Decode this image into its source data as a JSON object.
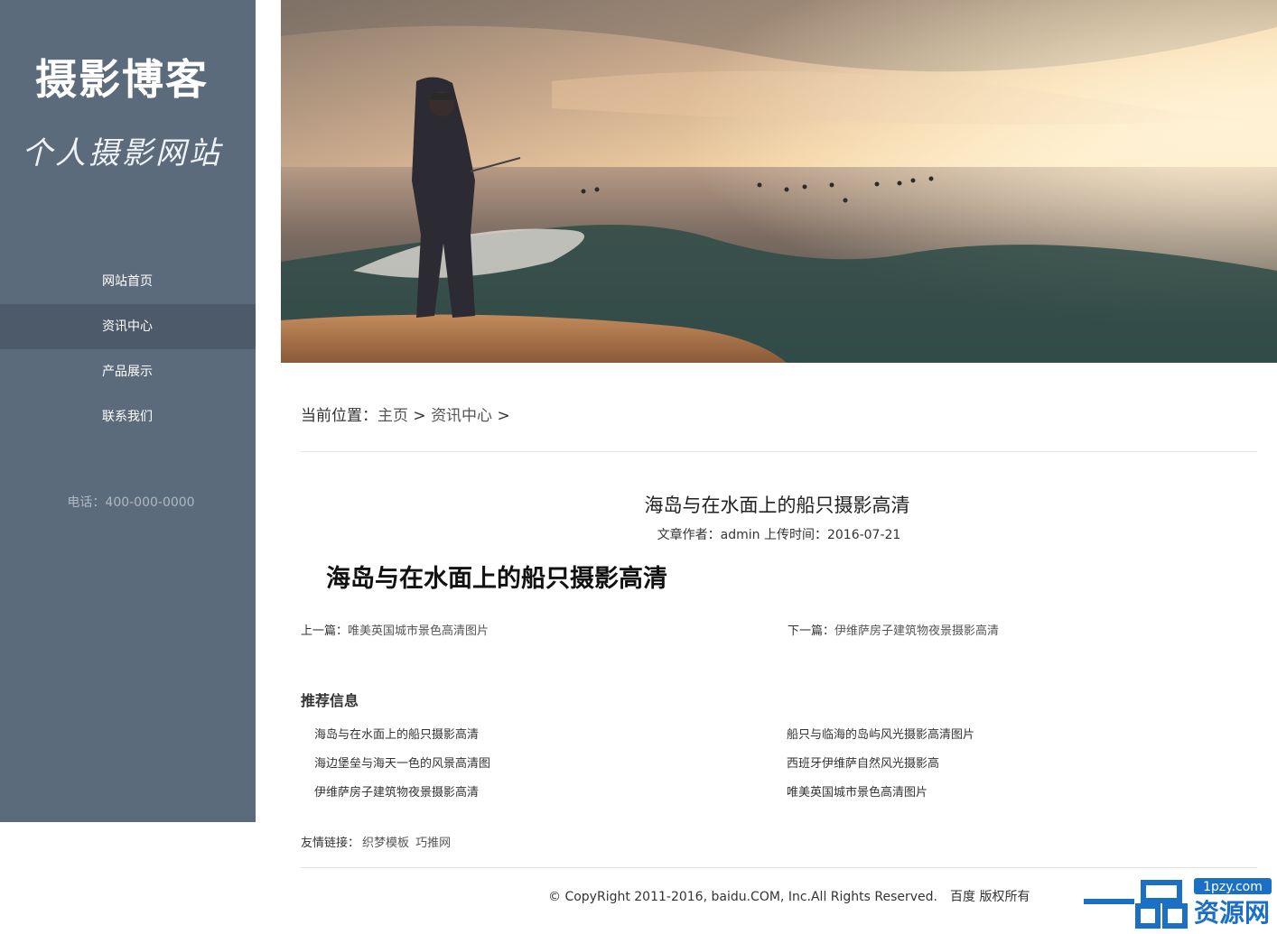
{
  "sidebar": {
    "title": "摄影博客",
    "subtitle": "个人摄影网站",
    "nav": [
      {
        "label": "网站首页",
        "active": false
      },
      {
        "label": "资讯中心",
        "active": true
      },
      {
        "label": "产品展示",
        "active": false
      },
      {
        "label": "联系我们",
        "active": false
      }
    ],
    "phone": "电话：400-000-0000"
  },
  "breadcrumb": {
    "prefix": "当前位置：",
    "home": "主页",
    "sep1": " > ",
    "section": "资讯中心",
    "sep2": " >"
  },
  "article": {
    "title": "海岛与在水面上的船只摄影高清",
    "meta": "文章作者：admin 上传时间：2016-07-21",
    "heading": "海岛与在水面上的船只摄影高清",
    "prev_label": "上一篇：",
    "prev_title": "唯美英国城市景色高清图片",
    "next_label": "下一篇：",
    "next_title": "伊维萨房子建筑物夜景摄影高清"
  },
  "recommend": {
    "title": "推荐信息",
    "left": [
      "海岛与在水面上的船只摄影高清",
      "海边堡垒与海天一色的风景高清图",
      "伊维萨房子建筑物夜景摄影高清"
    ],
    "right": [
      "船只与临海的岛屿风光摄影高清图片",
      "西班牙伊维萨自然风光摄影高",
      "唯美英国城市景色高清图片"
    ]
  },
  "friends": {
    "label": "友情链接：",
    "links": [
      "织梦模板",
      "巧推网"
    ]
  },
  "footer": {
    "copyright": "© CopyRight 2011-2016, baidu.COM, Inc.All Rights Reserved.　百度 版权所有"
  },
  "watermark": {
    "domain": "1pzy.com",
    "name": "资源网"
  }
}
